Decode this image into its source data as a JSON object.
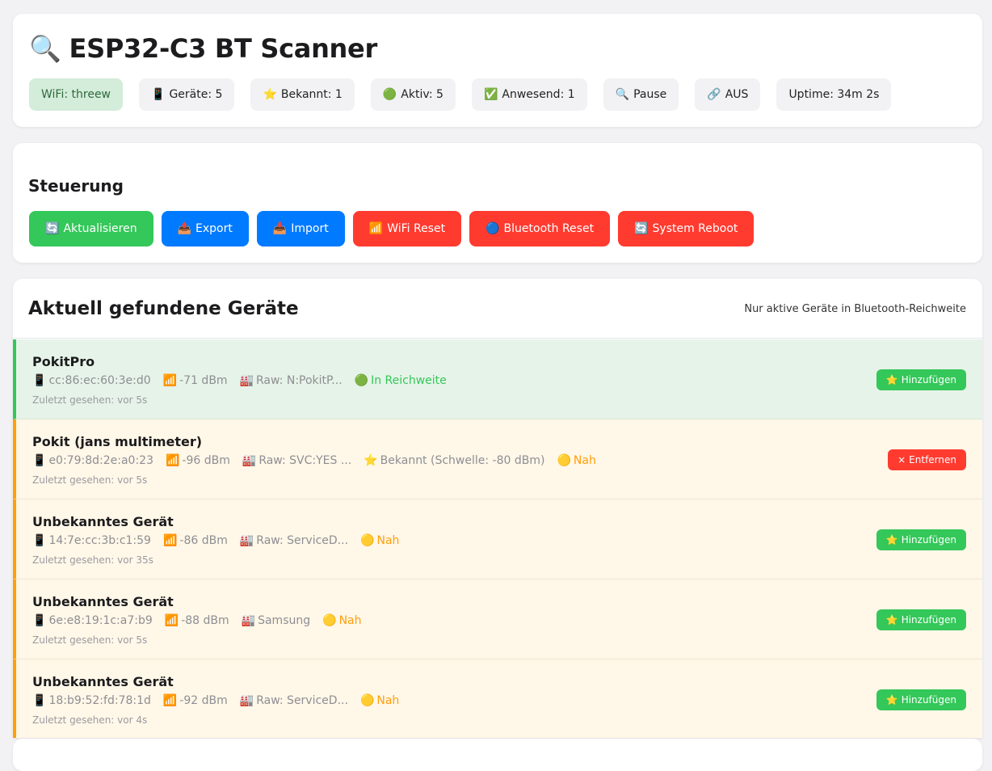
{
  "header": {
    "title_icon": "🔍",
    "title": "ESP32-C3 BT Scanner",
    "stats": [
      {
        "icon": "",
        "label": "WiFi: threew",
        "type": "wifi"
      },
      {
        "icon": "📱",
        "label": "Geräte: 5",
        "type": "devices"
      },
      {
        "icon": "⭐",
        "label": "Bekannt: 1",
        "type": "known"
      },
      {
        "icon": "🟢",
        "label": "Aktiv: 5",
        "type": "active"
      },
      {
        "icon": "✅",
        "label": "Anwesend: 1",
        "type": "present"
      },
      {
        "icon": "🔍",
        "label": "Pause",
        "type": "scan"
      },
      {
        "icon": "🔗",
        "label": "AUS",
        "type": "link"
      },
      {
        "icon": "",
        "label": "Uptime: 34m 2s",
        "type": "uptime"
      }
    ]
  },
  "controls": {
    "title": "Steuerung",
    "buttons": [
      {
        "icon": "🔄",
        "label": "Aktualisieren",
        "color": "#34c759",
        "name": "refresh-button"
      },
      {
        "icon": "📤",
        "label": "Export",
        "color": "#007aff",
        "name": "export-button"
      },
      {
        "icon": "📥",
        "label": "Import",
        "color": "#007aff",
        "name": "import-button"
      },
      {
        "icon": "📶",
        "label": "WiFi Reset",
        "color": "#ff3b30",
        "name": "wifi-reset-button"
      },
      {
        "icon": "🔵",
        "label": "Bluetooth Reset",
        "color": "#ff3b30",
        "name": "bluetooth-reset-button"
      },
      {
        "icon": "🔄",
        "label": "System Reboot",
        "color": "#ff3b30",
        "name": "system-reboot-button"
      }
    ]
  },
  "devices": {
    "title": "Aktuell gefundene Geräte",
    "subtitle": "Nur aktive Geräte in Bluetooth-Reichweite",
    "items": [
      {
        "name": "PokitPro",
        "mac": "cc:86:ec:60:3e:d0",
        "rssi": "-71 dBm",
        "vendor": "Raw: N:PokitP...",
        "known": "",
        "status_icon": "🟢",
        "status": "In Reichweite",
        "status_color": "green",
        "row_state": "in-range",
        "last_seen": "Zuletzt gesehen: vor 5s",
        "action_icon": "⭐",
        "action": "Hinzufügen",
        "action_type": "add"
      },
      {
        "name": "Pokit (jans multimeter)",
        "mac": "e0:79:8d:2e:a0:23",
        "rssi": "-96 dBm",
        "vendor": "Raw: SVC:YES ...",
        "known": "Bekannt (Schwelle: -80 dBm)",
        "status_icon": "🟡",
        "status": "Nah",
        "status_color": "orange",
        "row_state": "near",
        "last_seen": "Zuletzt gesehen: vor 5s",
        "action_icon": "×",
        "action": "Entfernen",
        "action_type": "remove"
      },
      {
        "name": "Unbekanntes Gerät",
        "mac": "14:7e:cc:3b:c1:59",
        "rssi": "-86 dBm",
        "vendor": "Raw: ServiceD...",
        "known": "",
        "status_icon": "🟡",
        "status": "Nah",
        "status_color": "orange",
        "row_state": "near",
        "last_seen": "Zuletzt gesehen: vor 35s",
        "action_icon": "⭐",
        "action": "Hinzufügen",
        "action_type": "add"
      },
      {
        "name": "Unbekanntes Gerät",
        "mac": "6e:e8:19:1c:a7:b9",
        "rssi": "-88 dBm",
        "vendor": "Samsung",
        "known": "",
        "status_icon": "🟡",
        "status": "Nah",
        "status_color": "orange",
        "row_state": "near",
        "last_seen": "Zuletzt gesehen: vor 5s",
        "action_icon": "⭐",
        "action": "Hinzufügen",
        "action_type": "add"
      },
      {
        "name": "Unbekanntes Gerät",
        "mac": "18:b9:52:fd:78:1d",
        "rssi": "-92 dBm",
        "vendor": "Raw: ServiceD...",
        "known": "",
        "status_icon": "🟡",
        "status": "Nah",
        "status_color": "orange",
        "row_state": "near",
        "last_seen": "Zuletzt gesehen: vor 4s",
        "action_icon": "⭐",
        "action": "Hinzufügen",
        "action_type": "add"
      }
    ]
  },
  "icons": {
    "mac_icon": "📱",
    "rssi_icon": "📶",
    "vendor_icon": "🏭",
    "known_icon": "⭐"
  }
}
